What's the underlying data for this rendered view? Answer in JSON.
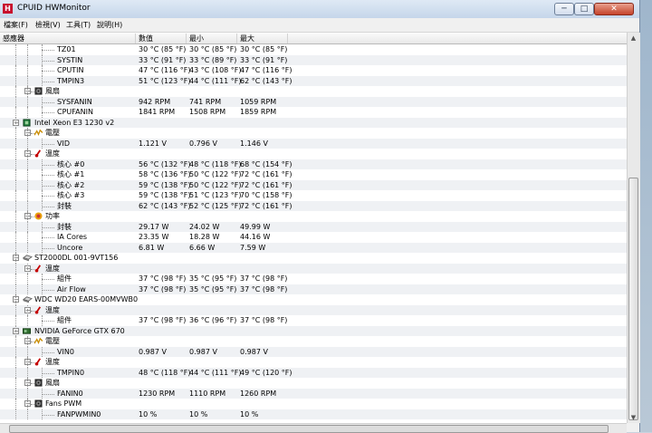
{
  "window": {
    "title": "CPUID HWMonitor",
    "icon_letter": "H",
    "buttons": {
      "minimize": "─",
      "maximize": "□",
      "close": "✕"
    }
  },
  "menu": [
    "檔案(F)",
    "檢視(V)",
    "工具(T)",
    "說明(H)"
  ],
  "columns": [
    "感應器",
    "數值",
    "最小",
    "最大"
  ],
  "rows": [
    {
      "level": 3,
      "kind": "sensor",
      "name": "TZ01",
      "value": "30 °C  (85 °F)",
      "min": "30 °C  (85 °F)",
      "max": "30 °C  (85 °F)"
    },
    {
      "level": 3,
      "kind": "sensor",
      "name": "SYSTIN",
      "value": "33 °C  (91 °F)",
      "min": "33 °C  (89 °F)",
      "max": "33 °C  (91 °F)"
    },
    {
      "level": 3,
      "kind": "sensor",
      "name": "CPUTIN",
      "value": "47 °C  (116 °F)",
      "min": "43 °C  (108 °F)",
      "max": "47 °C  (116 °F)"
    },
    {
      "level": 3,
      "kind": "sensor",
      "name": "TMPIN3",
      "value": "51 °C  (123 °F)",
      "min": "44 °C  (111 °F)",
      "max": "62 °C  (143 °F)"
    },
    {
      "level": 2,
      "kind": "category",
      "icon": "fan-icon",
      "name": "風扇"
    },
    {
      "level": 3,
      "kind": "sensor",
      "name": "SYSFANIN",
      "value": "942 RPM",
      "min": "741 RPM",
      "max": "1059 RPM"
    },
    {
      "level": 3,
      "kind": "sensor",
      "name": "CPUFANIN",
      "value": "1841 RPM",
      "min": "1508 RPM",
      "max": "1859 RPM"
    },
    {
      "level": 1,
      "kind": "device",
      "icon": "cpu-chip-icon",
      "name": "Intel Xeon E3 1230 v2"
    },
    {
      "level": 2,
      "kind": "category",
      "icon": "voltage-icon",
      "name": "電壓"
    },
    {
      "level": 3,
      "kind": "sensor",
      "name": "VID",
      "value": "1.121 V",
      "min": "0.796 V",
      "max": "1.146 V"
    },
    {
      "level": 2,
      "kind": "category",
      "icon": "thermometer-icon",
      "name": "溫度"
    },
    {
      "level": 3,
      "kind": "sensor",
      "name": "核心 #0",
      "value": "56 °C  (132 °F)",
      "min": "48 °C  (118 °F)",
      "max": "68 °C  (154 °F)"
    },
    {
      "level": 3,
      "kind": "sensor",
      "name": "核心 #1",
      "value": "58 °C  (136 °F)",
      "min": "50 °C  (122 °F)",
      "max": "72 °C  (161 °F)"
    },
    {
      "level": 3,
      "kind": "sensor",
      "name": "核心 #2",
      "value": "59 °C  (138 °F)",
      "min": "50 °C  (122 °F)",
      "max": "72 °C  (161 °F)"
    },
    {
      "level": 3,
      "kind": "sensor",
      "name": "核心 #3",
      "value": "59 °C  (138 °F)",
      "min": "51 °C  (123 °F)",
      "max": "70 °C  (158 °F)"
    },
    {
      "level": 3,
      "kind": "sensor",
      "name": "封裝",
      "value": "62 °C  (143 °F)",
      "min": "52 °C  (125 °F)",
      "max": "72 °C  (161 °F)"
    },
    {
      "level": 2,
      "kind": "category",
      "icon": "power-icon",
      "name": "功率"
    },
    {
      "level": 3,
      "kind": "sensor",
      "name": "封裝",
      "value": "29.17 W",
      "min": "24.02 W",
      "max": "49.99 W"
    },
    {
      "level": 3,
      "kind": "sensor",
      "name": "IA Cores",
      "value": "23.35 W",
      "min": "18.28 W",
      "max": "44.16 W"
    },
    {
      "level": 3,
      "kind": "sensor",
      "name": "Uncore",
      "value": "6.81 W",
      "min": "6.66 W",
      "max": "7.59 W"
    },
    {
      "level": 1,
      "kind": "device",
      "icon": "hard-disk-icon",
      "name": "ST2000DL 001-9VT156"
    },
    {
      "level": 2,
      "kind": "category",
      "icon": "thermometer-icon",
      "name": "溫度"
    },
    {
      "level": 3,
      "kind": "sensor",
      "name": "組件",
      "value": "37 °C  (98 °F)",
      "min": "35 °C  (95 °F)",
      "max": "37 °C  (98 °F)"
    },
    {
      "level": 3,
      "kind": "sensor",
      "name": "Air Flow",
      "value": "37 °C  (98 °F)",
      "min": "35 °C  (95 °F)",
      "max": "37 °C  (98 °F)"
    },
    {
      "level": 1,
      "kind": "device",
      "icon": "hard-disk-icon",
      "name": "WDC WD20 EARS-00MVWB0"
    },
    {
      "level": 2,
      "kind": "category",
      "icon": "thermometer-icon",
      "name": "溫度"
    },
    {
      "level": 3,
      "kind": "sensor",
      "name": "組件",
      "value": "37 °C  (98 °F)",
      "min": "36 °C  (96 °F)",
      "max": "37 °C  (98 °F)"
    },
    {
      "level": 1,
      "kind": "device",
      "icon": "graphics-card-icon",
      "name": "NVIDIA GeForce GTX 670"
    },
    {
      "level": 2,
      "kind": "category",
      "icon": "voltage-icon",
      "name": "電壓"
    },
    {
      "level": 3,
      "kind": "sensor",
      "name": "VIN0",
      "value": "0.987 V",
      "min": "0.987 V",
      "max": "0.987 V"
    },
    {
      "level": 2,
      "kind": "category",
      "icon": "thermometer-icon",
      "name": "溫度"
    },
    {
      "level": 3,
      "kind": "sensor",
      "name": "TMPIN0",
      "value": "48 °C  (118 °F)",
      "min": "44 °C  (111 °F)",
      "max": "49 °C  (120 °F)"
    },
    {
      "level": 2,
      "kind": "category",
      "icon": "fan-icon",
      "name": "風扇"
    },
    {
      "level": 3,
      "kind": "sensor",
      "name": "FANIN0",
      "value": "1230 RPM",
      "min": "1110 RPM",
      "max": "1260 RPM"
    },
    {
      "level": 2,
      "kind": "category",
      "icon": "fan-pwm-icon",
      "name": "Fans PWM"
    },
    {
      "level": 3,
      "kind": "sensor",
      "name": "FANPWMIN0",
      "value": "10 %",
      "min": "10 %",
      "max": "10 %"
    }
  ]
}
